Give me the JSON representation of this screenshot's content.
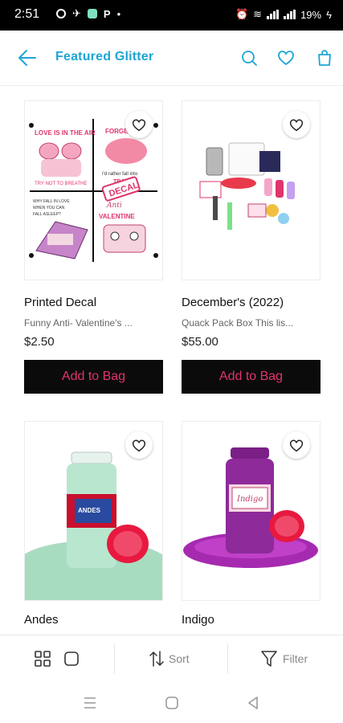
{
  "status": {
    "time": "2:51",
    "battery": "19%"
  },
  "header": {
    "title": "Featured Glitter",
    "back_icon": "back-arrow-icon",
    "search_icon": "search-icon",
    "wishlist_icon": "heart-icon",
    "bag_icon": "shopping-bag-icon"
  },
  "products": [
    {
      "name": "Printed Decal",
      "desc": "Funny Anti- Valentine's ...",
      "price": "$2.50",
      "button": "Add to Bag",
      "image": "decal-sheet-image"
    },
    {
      "name": "December's (2022)",
      "desc": "Quack Pack Box This lis...",
      "price": "$55.00",
      "button": "Add to Bag",
      "image": "craft-box-image"
    },
    {
      "name": "Andes",
      "image": "mint-glitter-jar-image"
    },
    {
      "name": "Indigo",
      "image": "purple-glitter-jar-image"
    }
  ],
  "decal_art": {
    "tl": "LOVE IS IN THE AIR / TRY NOT TO BREATHE",
    "tr": "FORGE IT / I'd rather fall into TRAFFIC",
    "bl": "WHY FALL IN LOVE WHEN YOU CAN FALL ASLEEP?",
    "br": "Anti VALENTINE",
    "badge": "DECAL"
  },
  "jar_labels": {
    "andes": "ANDES",
    "indigo": "Indigo"
  },
  "bottom_bar": {
    "sort": "Sort",
    "filter": "Filter"
  },
  "colors": {
    "accent": "#1ea5d6",
    "button_bg": "#0b0b0b",
    "button_text": "#e0356a"
  }
}
